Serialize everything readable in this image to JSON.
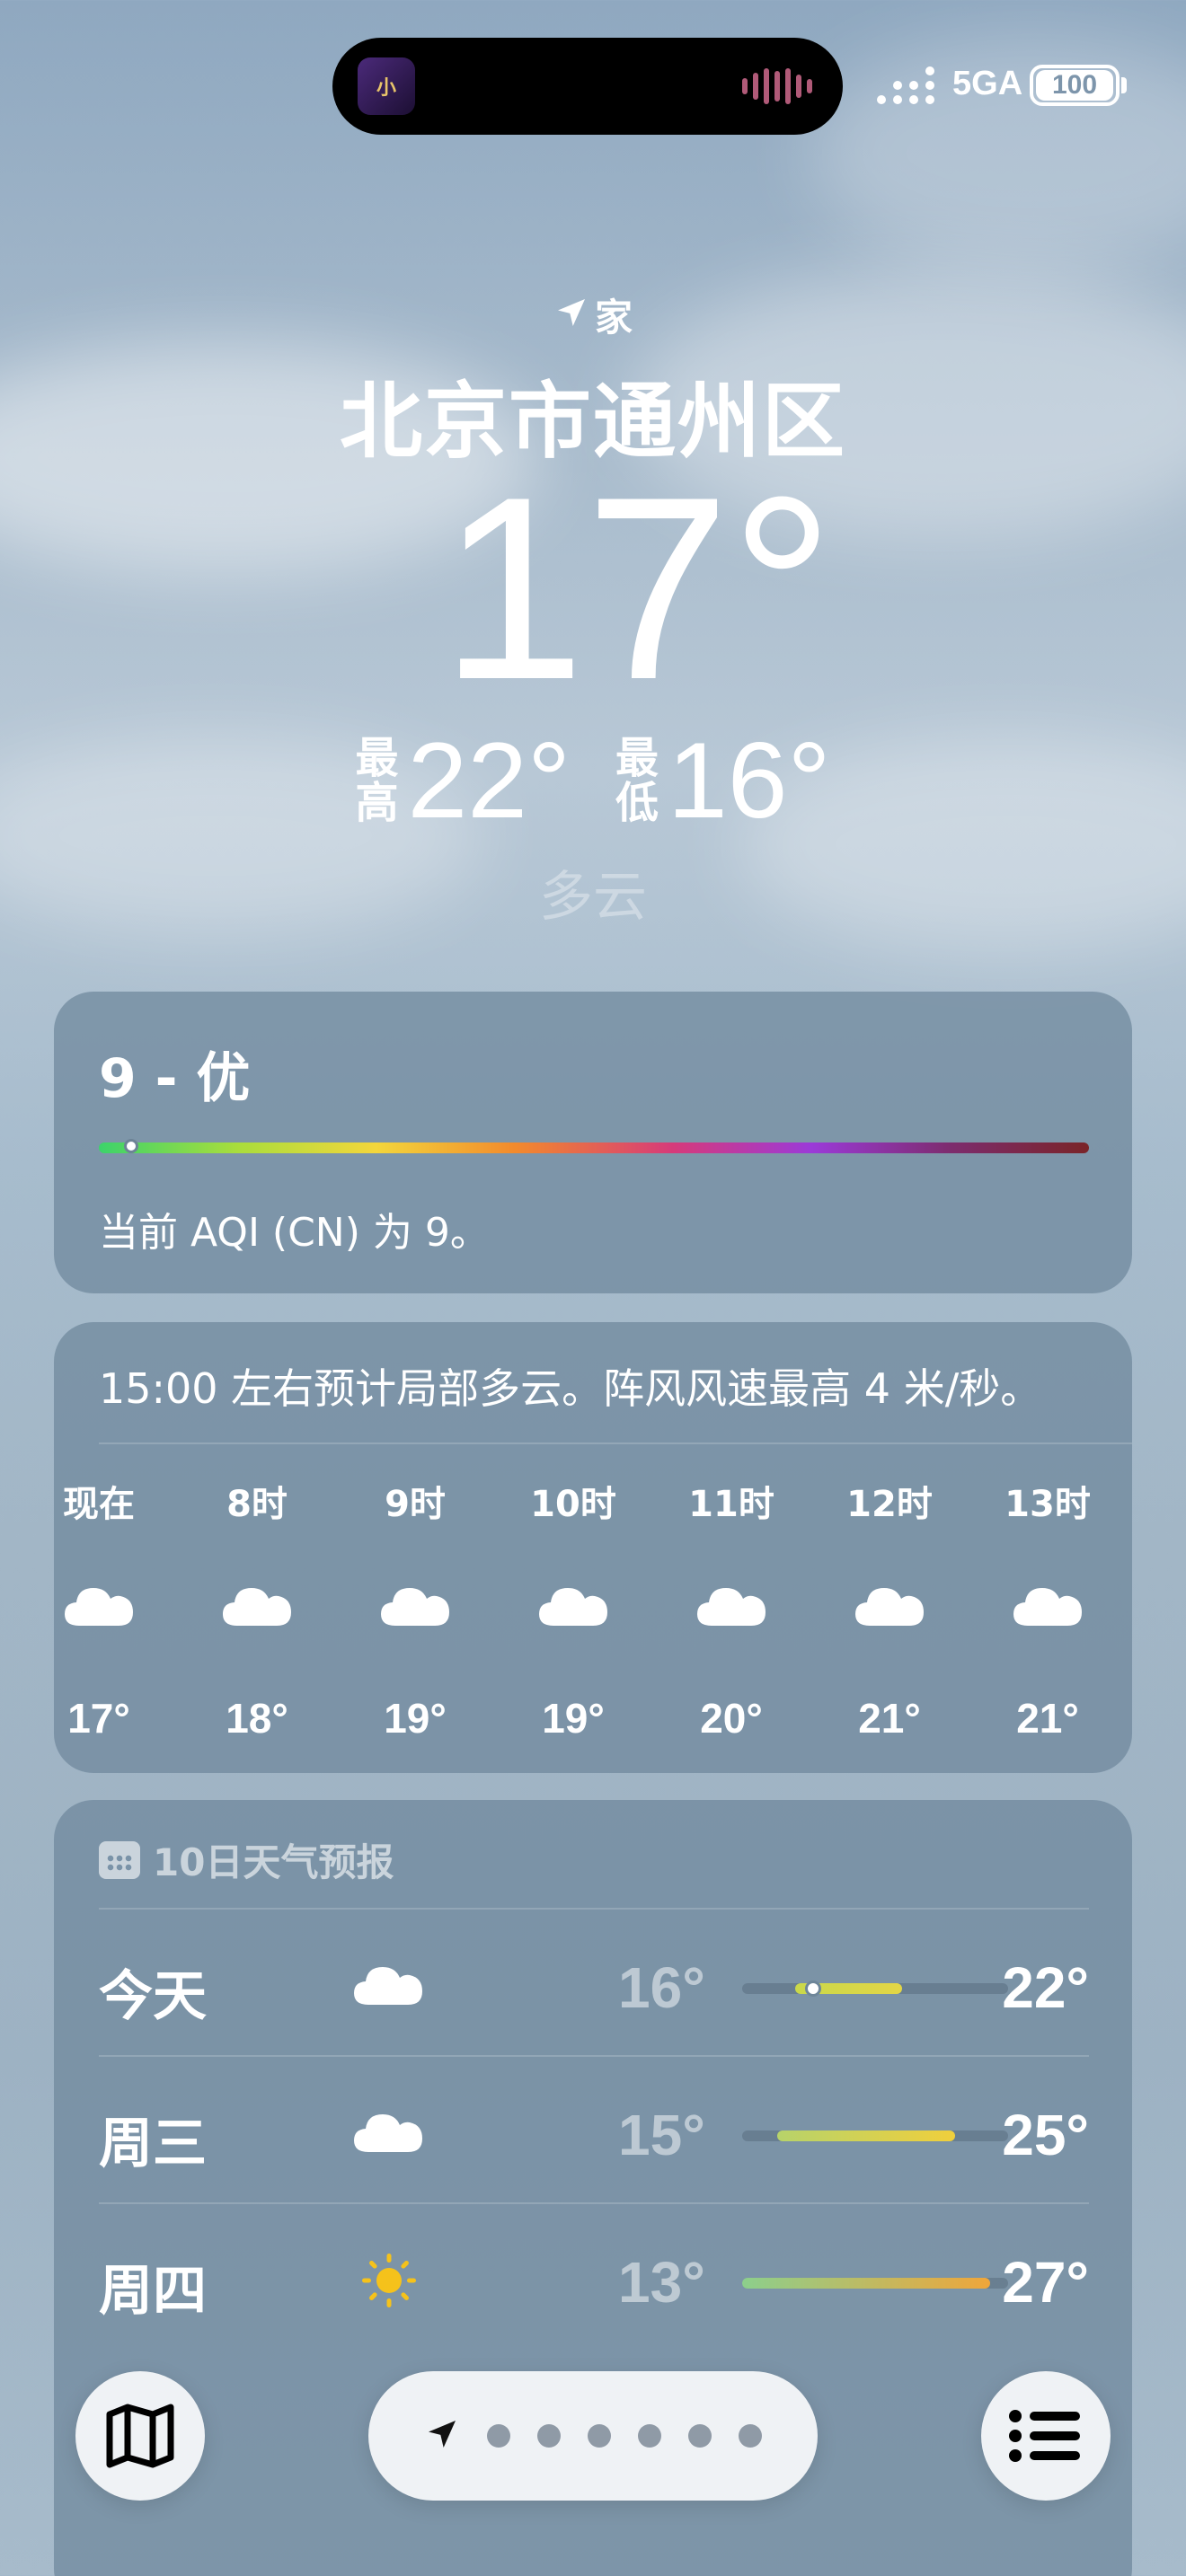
{
  "status_bar": {
    "network": "5GA",
    "battery": "100",
    "live_activity_icon": "game-app-icon",
    "live_activity_app_label": "小"
  },
  "header": {
    "location_icon": "location-arrow-icon",
    "location_label": "家",
    "city": "北京市通州区",
    "temperature": "17°",
    "high_label": "最高",
    "high": "22°",
    "low_label": "最低",
    "low": "16°",
    "condition": "多云"
  },
  "aqi": {
    "title": "9 - 优",
    "value": 9,
    "scale_max": 500,
    "description": "当前 AQI (CN) 为 9。"
  },
  "hourly": {
    "summary": "15:00 左右预计局部多云。阵风风速最高 4 米/秒。",
    "items": [
      {
        "time": "现在",
        "icon": "cloud-icon",
        "temp": "17°"
      },
      {
        "time": "8时",
        "icon": "cloud-icon",
        "temp": "18°"
      },
      {
        "time": "9时",
        "icon": "cloud-icon",
        "temp": "19°"
      },
      {
        "time": "10时",
        "icon": "cloud-icon",
        "temp": "19°"
      },
      {
        "time": "11时",
        "icon": "cloud-icon",
        "temp": "20°"
      },
      {
        "time": "12时",
        "icon": "cloud-icon",
        "temp": "21°"
      },
      {
        "time": "13时",
        "icon": "cloud-icon",
        "temp": "21°"
      }
    ]
  },
  "daily": {
    "header_icon": "calendar-icon",
    "title": "10日天气预报",
    "range_min": 13,
    "range_max": 28,
    "rows": [
      {
        "day": "今天",
        "icon": "cloud-icon",
        "low": "16°",
        "high": "22°",
        "low_value": 16,
        "high_value": 22,
        "current": 17,
        "colors": [
          "#c9d84a",
          "#e3d646"
        ]
      },
      {
        "day": "周三",
        "icon": "cloud-icon",
        "low": "15°",
        "high": "25°",
        "low_value": 15,
        "high_value": 25,
        "colors": [
          "#b7d36a",
          "#f0cf3c"
        ]
      },
      {
        "day": "周四",
        "icon": "sun-icon",
        "low": "13°",
        "high": "27°",
        "low_value": 13,
        "high_value": 27,
        "colors": [
          "#8ccf8c",
          "#f0a63a"
        ]
      }
    ]
  },
  "toolbar": {
    "map_icon": "map-icon",
    "location_icon": "location-arrow-icon",
    "page_dots": 6,
    "list_icon": "list-icon"
  }
}
